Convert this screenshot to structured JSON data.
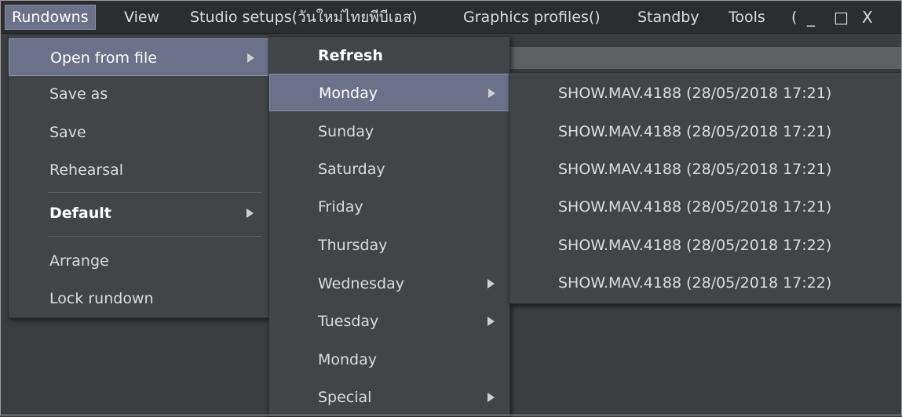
{
  "menubar": {
    "items": [
      {
        "label": "Rundowns"
      },
      {
        "label": "View"
      },
      {
        "label": "Studio setups(วันใหม่ไทยพีบีเอส)"
      },
      {
        "label": "Graphics profiles()"
      },
      {
        "label": "Standby"
      },
      {
        "label": "Tools"
      },
      {
        "label": "("
      }
    ],
    "window_controls": {
      "minimize": "_",
      "maximize": "□",
      "close": "X"
    }
  },
  "rundowns_menu": {
    "items": [
      {
        "label": "Open from file"
      },
      {
        "label": "Save as"
      },
      {
        "label": "Save"
      },
      {
        "label": "Rehearsal"
      },
      {
        "label": "Default"
      },
      {
        "label": "Arrange"
      },
      {
        "label": "Lock rundown"
      }
    ]
  },
  "open_submenu": {
    "items": [
      {
        "label": "Refresh"
      },
      {
        "label": "Monday"
      },
      {
        "label": "Sunday"
      },
      {
        "label": "Saturday"
      },
      {
        "label": "Friday"
      },
      {
        "label": "Thursday"
      },
      {
        "label": "Wednesday"
      },
      {
        "label": "Tuesday"
      },
      {
        "label": "Monday"
      },
      {
        "label": "Special"
      }
    ]
  },
  "monday_submenu": {
    "items": [
      {
        "label": "SHOW.MAV.4188 (28/05/2018 17:21)"
      },
      {
        "label": "SHOW.MAV.4188 (28/05/2018 17:21)"
      },
      {
        "label": "SHOW.MAV.4188 (28/05/2018 17:21)"
      },
      {
        "label": "SHOW.MAV.4188 (28/05/2018 17:21)"
      },
      {
        "label": "SHOW.MAV.4188 (28/05/2018 17:22)"
      },
      {
        "label": "SHOW.MAV.4188 (28/05/2018 17:22)"
      }
    ]
  },
  "colors": {
    "menubar_bg": "#2b2d30",
    "menu_bg": "#424548",
    "highlight": "#6b7189",
    "text": "#dcdcdc"
  }
}
